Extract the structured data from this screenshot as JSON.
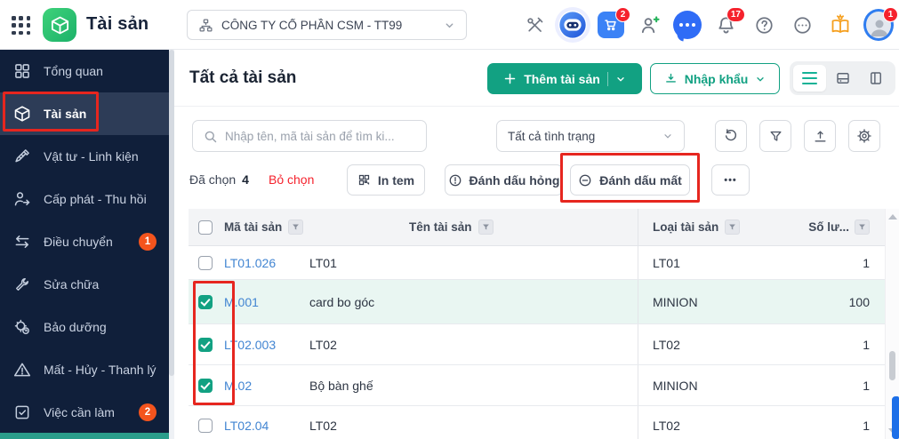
{
  "colors": {
    "brand_teal": "#12a182",
    "sidebar_navy": "#101f3a",
    "link_blue": "#4285d2",
    "annotation_red": "#e6261f",
    "badge_red": "#f5222d",
    "badge_orange": "#f4541d",
    "row_highlight": "#e9f6f2"
  },
  "icons": {
    "app-launcher": "grid-9-dots",
    "logo": "cube",
    "company": "sitemap",
    "tools": "crossed-tools",
    "assistant": "robot",
    "cart": "shopping-cart",
    "invite": "user-plus",
    "chat": "speech-bubble",
    "notifications": "bell",
    "help": "question-circle",
    "more": "ellipsis-circle",
    "guide": "open-book-bulb",
    "search": "magnifier",
    "refresh": "rotate-arrow",
    "filter": "funnel",
    "export": "upload-tray",
    "settings": "gear",
    "print": "qr-code",
    "mark-broken": "exclamation-circle",
    "mark-lost": "minus-circle"
  },
  "topbar": {
    "app_title": "Tài sản",
    "company": "CÔNG TY CỔ PHẦN CSM - TT99",
    "cart_badge": "2",
    "bell_badge": "17",
    "avatar_badge": "1"
  },
  "sidebar": {
    "items": [
      {
        "label": "Tổng quan"
      },
      {
        "label": "Tài sản",
        "active": true
      },
      {
        "label": "Vật tư - Linh kiện"
      },
      {
        "label": "Cấp phát - Thu hồi"
      },
      {
        "label": "Điều chuyển",
        "badge": "1"
      },
      {
        "label": "Sửa chữa"
      },
      {
        "label": "Bảo dưỡng"
      },
      {
        "label": "Mất - Hủy - Thanh lý"
      },
      {
        "label": "Việc cần làm",
        "badge": "2"
      }
    ]
  },
  "main": {
    "page_title": "Tất cả tài sản",
    "add_asset_label": "Thêm tài sản",
    "import_label": "Nhập khẩu",
    "search_placeholder": "Nhập tên, mã tài sản để tìm ki...",
    "status_filter_value": "Tất cả tình trạng",
    "selected_label": "Đã chọn",
    "selected_count": "4",
    "deselect_label": "Bỏ chọn",
    "print_label": "In tem",
    "mark_broken_label": "Đánh dấu hỏng",
    "mark_lost_label": "Đánh dấu mất",
    "more_label": "•••"
  },
  "table": {
    "headers": {
      "code": "Mã tài sản",
      "name": "Tên tài sản",
      "type": "Loại tài sản",
      "qty": "Số lư..."
    },
    "rows": [
      {
        "code": "LT01.026",
        "name": "LT01",
        "type": "LT01",
        "qty": "1",
        "checked": false
      },
      {
        "code": "M.001",
        "name": "card bo góc",
        "type": "MINION",
        "qty": "100",
        "checked": true,
        "highlighted": true
      },
      {
        "code": "LT02.003",
        "name": "LT02",
        "type": "LT02",
        "qty": "1",
        "checked": true
      },
      {
        "code": "M.02",
        "name": "Bộ bàn ghế",
        "type": "MINION",
        "qty": "1",
        "checked": true
      },
      {
        "code": "LT02.04",
        "name": "LT02",
        "type": "LT02",
        "qty": "1",
        "checked": false
      }
    ]
  }
}
